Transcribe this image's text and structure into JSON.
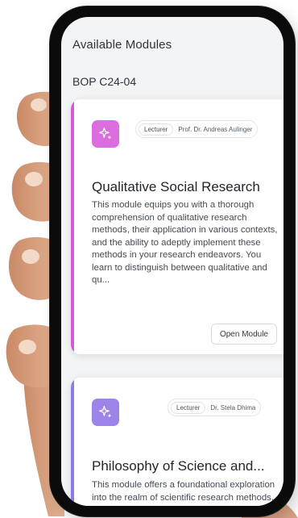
{
  "header": {
    "title": "Available Modules",
    "group_code": "BOP C24-04"
  },
  "modules": [
    {
      "icon": "sparkle-icon",
      "accent_color": "#d35ad6",
      "lecturer_tag": "Lecturer",
      "lecturer_name": "Prof. Dr. Andreas Aulinger",
      "title": "Qualitative Social Research",
      "description": "This module equips you with a thorough comprehension of qualitative research methods, their application in various contexts, and the ability to adeptly implement these methods in your research endeavors. You learn to distinguish between qualitative and qu...",
      "button_label": "Open Module"
    },
    {
      "icon": "sparkle-icon",
      "accent_color": "#8b7de8",
      "lecturer_tag": "Lecturer",
      "lecturer_name": "Dr. Stela Dhima",
      "title": "Philosophy of Science and...",
      "description": "This module offers a foundational exploration into the realm of scientific research methods, equipping you with"
    }
  ]
}
